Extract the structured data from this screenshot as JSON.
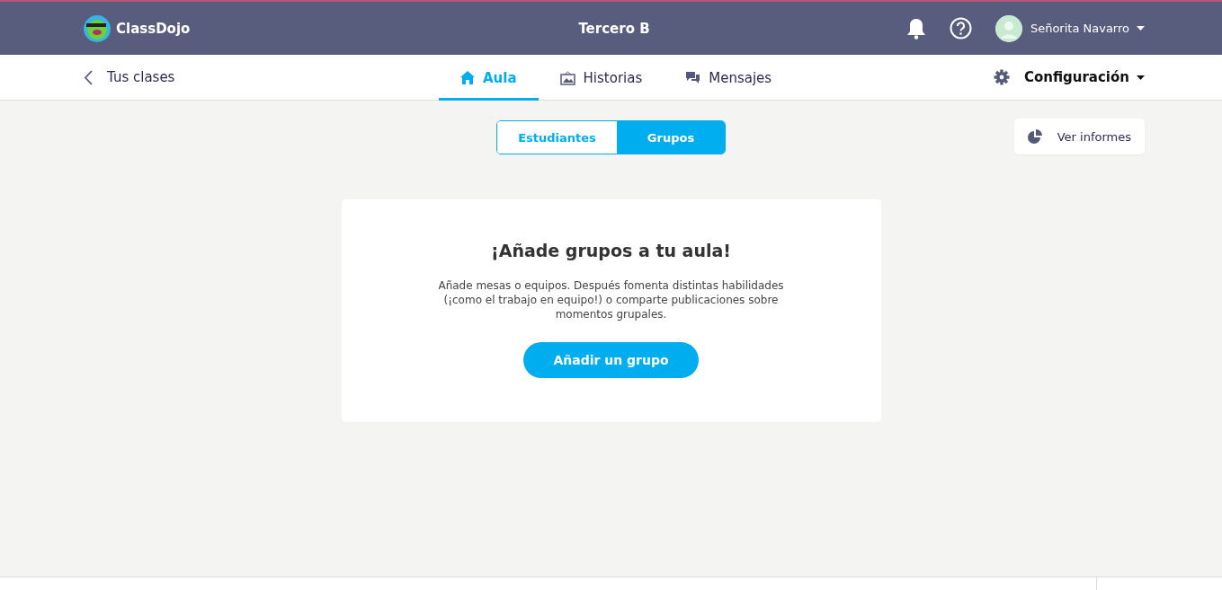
{
  "top_bar": {
    "logo": "ClassDojo",
    "class_name": "Tercero B",
    "user_name": "Señorita Navarro"
  },
  "nav": {
    "back_label": "Tus clases",
    "tabs": [
      {
        "label": "Aula",
        "selected": true
      },
      {
        "label": "Historias",
        "selected": false
      },
      {
        "label": "Mensajes",
        "selected": false
      }
    ],
    "settings_label": "Configuración"
  },
  "view_toggle": [
    {
      "label": "Estudiantes",
      "selected": false
    },
    {
      "label": "Grupos",
      "selected": true
    }
  ],
  "report_button": "Ver informes",
  "empty_state": {
    "title": "¡Añade grupos a tu aula!",
    "text": "Añade mesas o equipos. Después fomenta distintas habilidades (¡como el trabajo en equipo!) o comparte publicaciones sobre momentos grupales.",
    "button": "Añadir un grupo"
  }
}
